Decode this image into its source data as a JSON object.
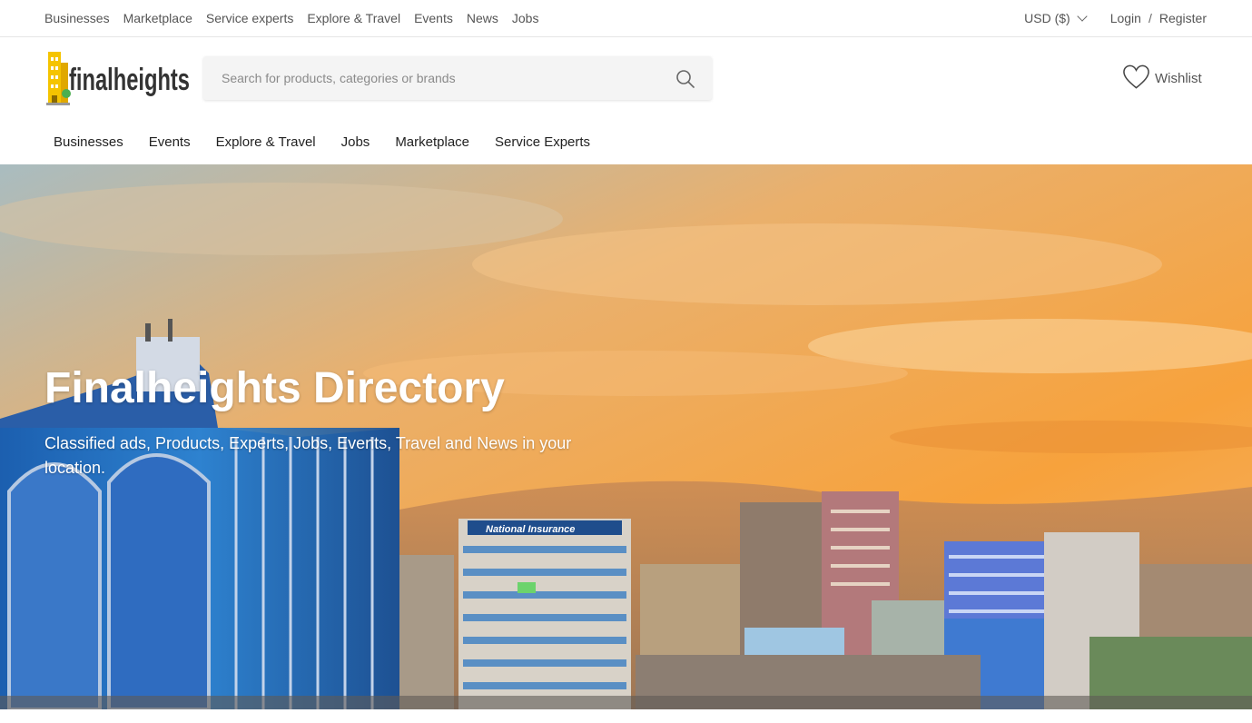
{
  "top_nav": {
    "links": [
      "Businesses",
      "Marketplace",
      "Service experts",
      "Explore & Travel",
      "Events",
      "News",
      "Jobs"
    ]
  },
  "top_right": {
    "currency": "USD ($)",
    "login": "Login",
    "separator": "/",
    "register": "Register"
  },
  "header": {
    "logo_text": "finalheights",
    "search_placeholder": "Search for products, categories or brands",
    "wishlist_label": "Wishlist"
  },
  "main_nav": {
    "links": [
      "Businesses",
      "Events",
      "Explore & Travel",
      "Jobs",
      "Marketplace",
      "Service Experts"
    ]
  },
  "hero": {
    "title": "Finalheights Directory",
    "subtitle": "Classified ads, Products, Experts, Jobs, Events, Travel and News in your location.",
    "building_sign": "National Insurance"
  },
  "colors": {
    "logo_yellow": "#f5c400",
    "sky_orange": "#f5a042",
    "text_dark": "#222222",
    "text_muted": "#555555"
  }
}
